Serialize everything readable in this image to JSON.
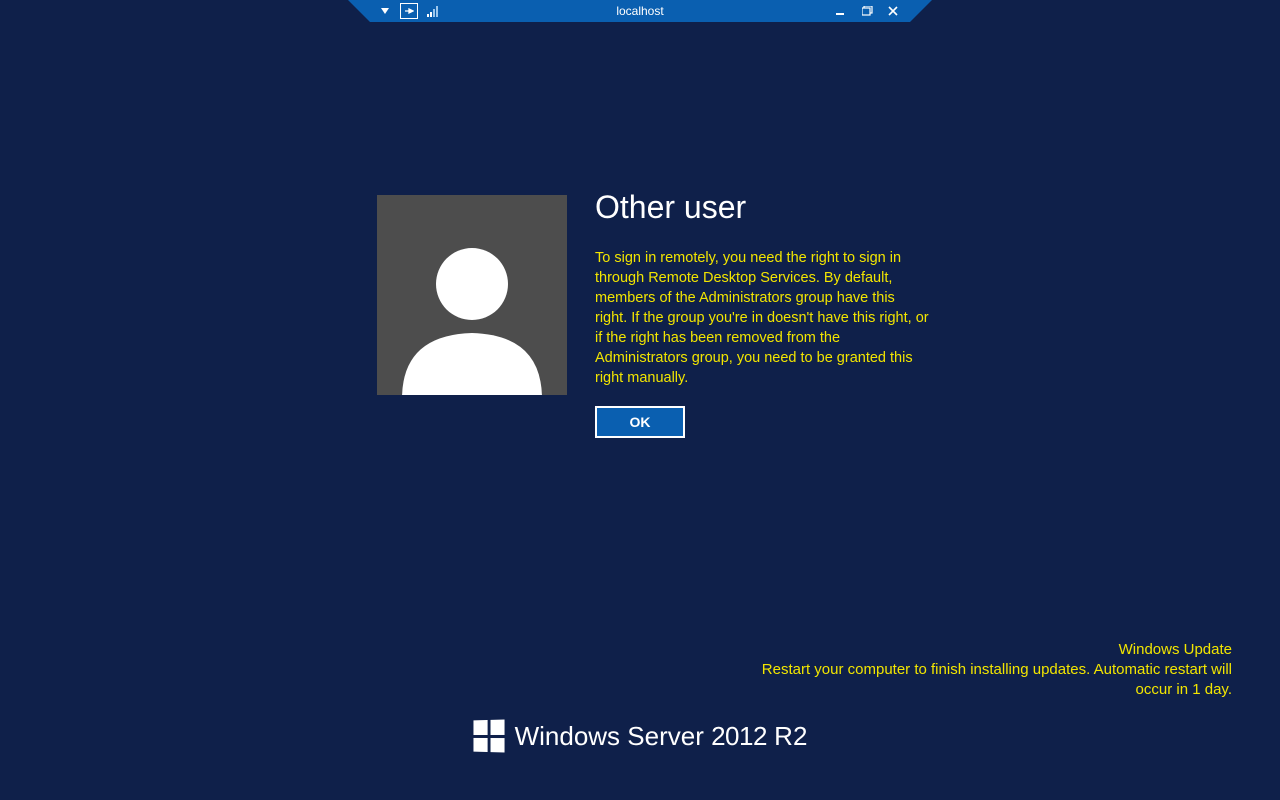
{
  "titlebar": {
    "title": "localhost"
  },
  "login": {
    "user_title": "Other user",
    "error_message": "To sign in remotely, you need the right to sign in through Remote Desktop Services. By default, members of the Administrators group have this right. If the group you're in doesn't have this right, or if the right has been removed from the Administrators group, you need to be granted this right manually.",
    "ok_label": "OK"
  },
  "update": {
    "title": "Windows Update",
    "message": "Restart your computer to finish installing updates. Automatic restart will occur in 1 day."
  },
  "branding": {
    "product": "Windows Server",
    "year": "2012",
    "suffix": "R2"
  }
}
